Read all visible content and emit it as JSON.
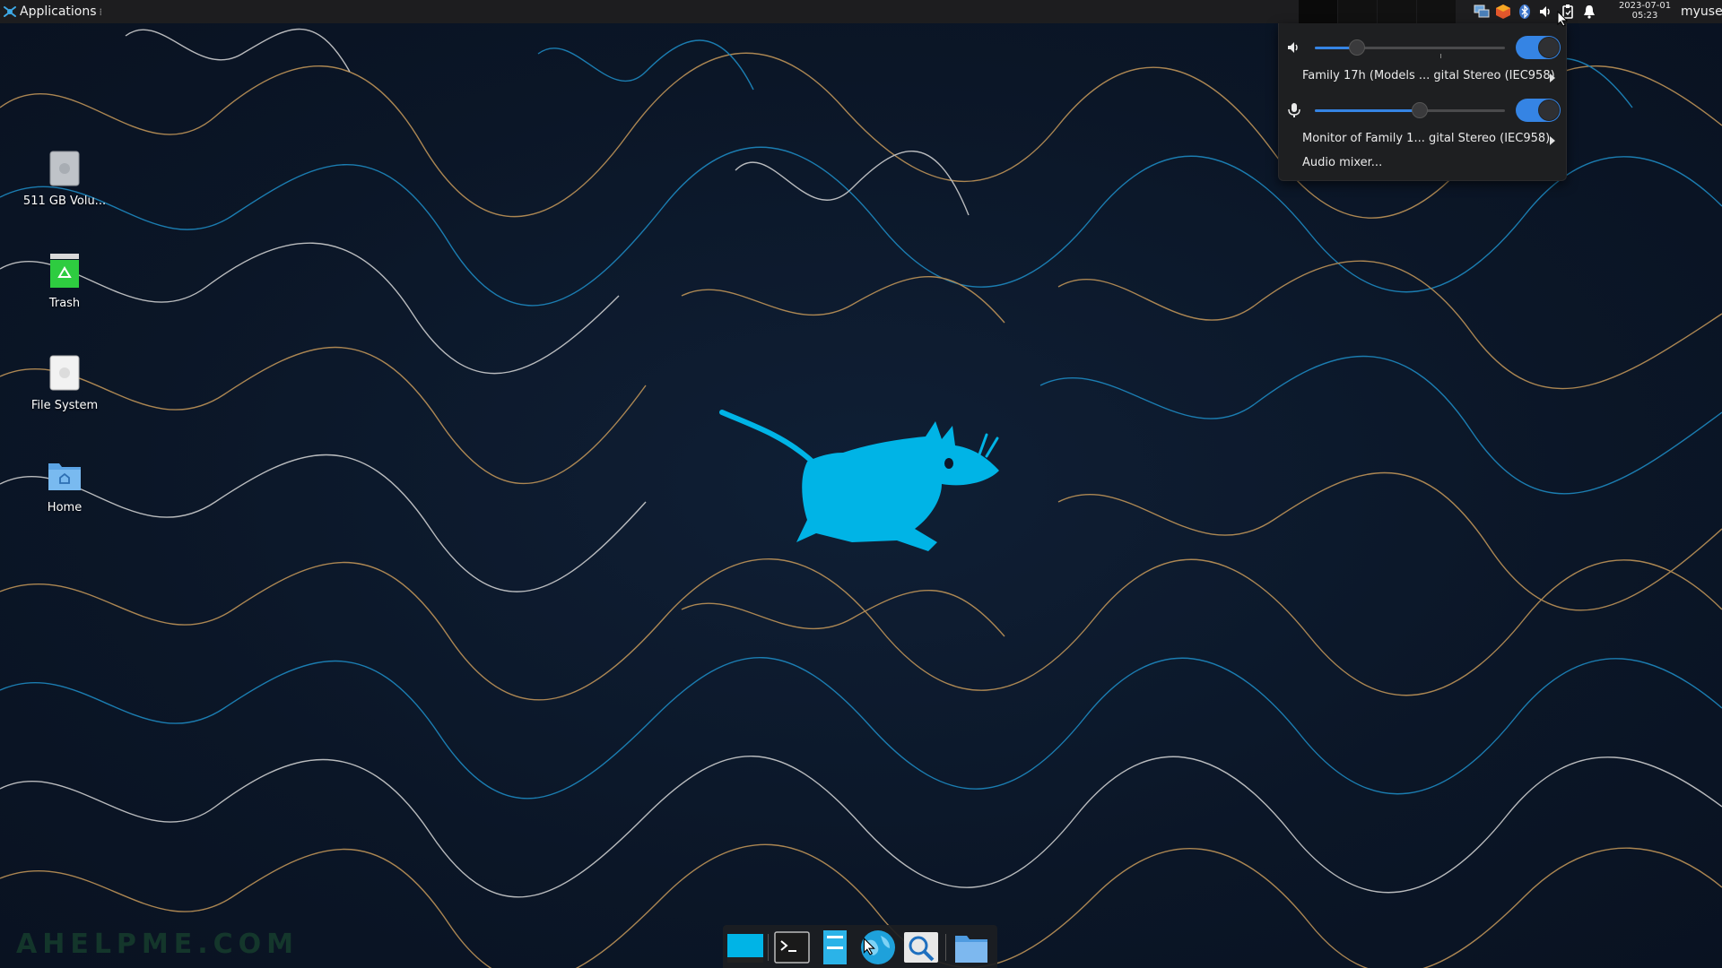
{
  "top_panel": {
    "applications_label": "Applications",
    "clock_date": "2023-07-01",
    "clock_time": "05:23",
    "user": "myuser",
    "tray_icons": [
      "network-icon",
      "package-updater-icon",
      "bluetooth-icon",
      "volume-icon",
      "clipboard-icon",
      "notifications-bell-icon"
    ]
  },
  "desktop_icons": [
    {
      "label": "511 GB Volu...",
      "icon": "drive-icon"
    },
    {
      "label": "Trash",
      "icon": "trash-icon"
    },
    {
      "label": "File System",
      "icon": "filesystem-drive-icon"
    },
    {
      "label": "Home",
      "icon": "home-folder-icon"
    }
  ],
  "sound_popup": {
    "output": {
      "icon": "speaker-icon",
      "volume_fraction": 0.22,
      "enabled": true,
      "device": "Family 17h (Models ... gital Stereo (IEC958)"
    },
    "input": {
      "icon": "microphone-icon",
      "volume_fraction": 0.55,
      "enabled": true,
      "device": "Monitor of Family 1... gital Stereo (IEC958)"
    },
    "mixer_label": "Audio mixer..."
  },
  "dock": {
    "items": [
      "show-desktop-icon",
      "terminal-icon",
      "file-manager-icon",
      "web-browser-icon",
      "app-finder-icon",
      "folder-icon"
    ]
  },
  "watermark": "AHELPME.COM",
  "colors": {
    "panel": "#1d1d1f",
    "accent": "#3584e4",
    "wallpaper_bg": "#0c1729",
    "line_orange": "#c89a5a",
    "line_blue": "#1e8fc9",
    "line_white": "#d8d8d8",
    "mouse_logo": "#00b4e6"
  }
}
